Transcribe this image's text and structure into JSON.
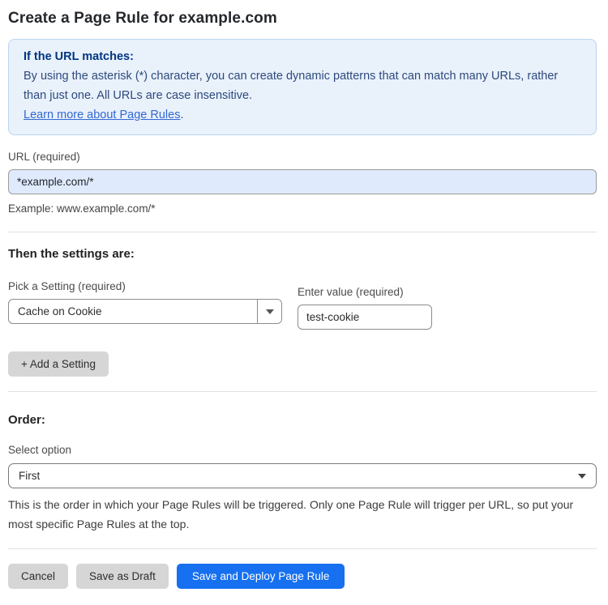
{
  "page": {
    "title": "Create a Page Rule for example.com"
  },
  "info_box": {
    "heading": "If the URL matches:",
    "body": "By using the asterisk (*) character, you can create dynamic patterns that can match many URLs, rather than just one. All URLs are case insensitive.",
    "link_label": "Learn more about Page Rules",
    "link_suffix": "."
  },
  "url_field": {
    "label": "URL (required)",
    "value": "*example.com/*",
    "helper": "Example: www.example.com/*"
  },
  "settings": {
    "heading": "Then the settings are:",
    "setting_label": "Pick a Setting (required)",
    "setting_selected": "Cache on Cookie",
    "value_label": "Enter value (required)",
    "value_value": "test-cookie",
    "add_button_label": "+ Add a Setting"
  },
  "order": {
    "heading": "Order:",
    "select_label": "Select option",
    "selected_option": "First",
    "helper": "This is the order in which your Page Rules will be triggered. Only one Page Rule will trigger per URL, so put your most specific Page Rules at the top."
  },
  "footer": {
    "cancel_label": "Cancel",
    "save_draft_label": "Save as Draft",
    "save_deploy_label": "Save and Deploy Page Rule"
  },
  "colors": {
    "info_box_bg": "#e9f1fb",
    "info_box_border": "#bcd4ee",
    "info_heading_text": "#003580",
    "info_body_text": "#2d4a7d",
    "link_blue": "#3268d3",
    "url_input_bg": "#dfeafd",
    "primary_button_bg": "#1670f0",
    "gray_button_bg": "#d6d6d6"
  }
}
